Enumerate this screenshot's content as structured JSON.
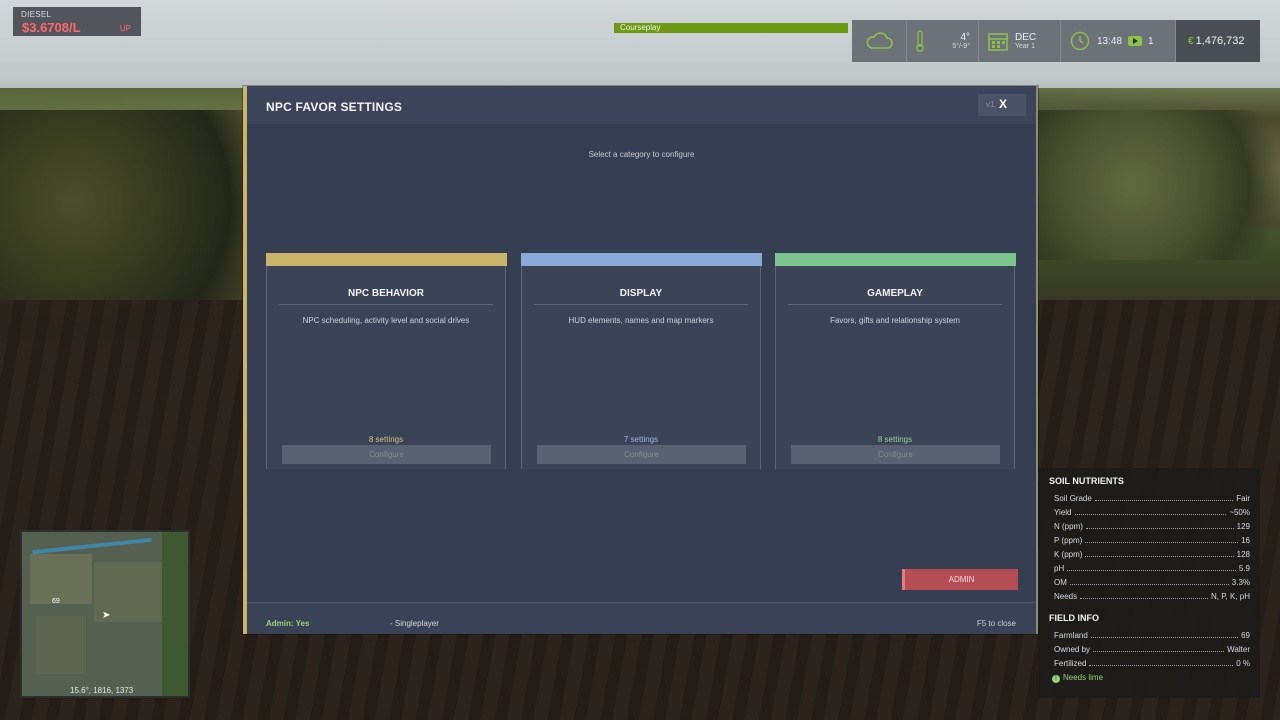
{
  "diesel": {
    "label": "DIESEL",
    "price": "$3.6708/L",
    "trend": "UP"
  },
  "courseplay": {
    "label": "Courseplay"
  },
  "hud": {
    "temp_current": "4°",
    "temp_range": "5°/-9°",
    "month": "DEC",
    "year": "Year 1",
    "time": "13:48",
    "speed": "1",
    "money": "1,476,732",
    "currency_symbol": "€"
  },
  "dialog": {
    "title": "NPC FAVOR SETTINGS",
    "version": "v1.",
    "close_label": "X",
    "subtitle": "Select a category to configure",
    "cards": [
      {
        "title": "NPC BEHAVIOR",
        "description": "NPC scheduling, activity level and social drives",
        "count": "8 settings",
        "button": "Configure",
        "accent": "#c9b46a"
      },
      {
        "title": "DISPLAY",
        "description": "HUD elements, names and map markers",
        "count": "7 settings",
        "button": "Configure",
        "accent": "#8aa9d6"
      },
      {
        "title": "GAMEPLAY",
        "description": "Favors, gifts and relationship system",
        "count": "8 settings",
        "button": "Configure",
        "accent": "#7cc58f"
      }
    ],
    "admin_button": "ADMIN",
    "footer": {
      "admin_status": "Admin: Yes",
      "mode": "- Singleplayer",
      "hint": "F5 to close"
    }
  },
  "minimap": {
    "coords": "15.6°, 1816, 1373",
    "marker_label": "69"
  },
  "soil": {
    "title": "SOIL NUTRIENTS",
    "rows": [
      {
        "k": "Soil Grade",
        "v": "Fair"
      },
      {
        "k": "Yield",
        "v": "~50%"
      },
      {
        "k": "N (ppm)",
        "v": "129"
      },
      {
        "k": "P (ppm)",
        "v": "16"
      },
      {
        "k": "K (ppm)",
        "v": "128"
      },
      {
        "k": "pH",
        "v": "5.9"
      },
      {
        "k": "OM",
        "v": "3.3%"
      },
      {
        "k": "Needs",
        "v": "N, P, K, pH"
      }
    ]
  },
  "field": {
    "title": "FIELD INFO",
    "rows": [
      {
        "k": "Farmland",
        "v": "69"
      },
      {
        "k": "Owned by",
        "v": "Walter"
      },
      {
        "k": "Fertilized",
        "v": "0 %"
      }
    ],
    "needs_lime": "Needs lime"
  }
}
